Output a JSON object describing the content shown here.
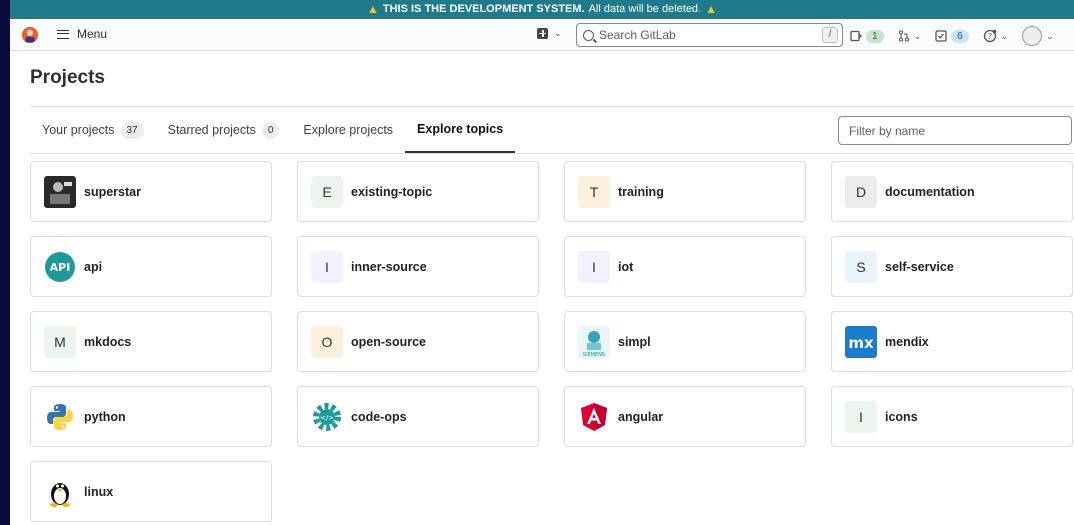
{
  "banner": {
    "strong": "THIS IS THE DEVELOPMENT SYSTEM.",
    "text": "All data will be deleted."
  },
  "header": {
    "menu_label": "Menu",
    "search_placeholder": "Search GitLab",
    "search_shortcut": "/",
    "issues_count": "1",
    "todos_count": "6"
  },
  "page": {
    "title": "Projects",
    "tabs": [
      {
        "label": "Your projects",
        "count": "37"
      },
      {
        "label": "Starred projects",
        "count": "0"
      },
      {
        "label": "Explore projects"
      },
      {
        "label": "Explore topics"
      }
    ],
    "filter_placeholder": "Filter by name"
  },
  "topics": [
    {
      "name": "superstar",
      "letter": "",
      "icon": "superstar-photo",
      "bg": "#333333"
    },
    {
      "name": "existing-topic",
      "letter": "E",
      "bg": "#ecf4ee"
    },
    {
      "name": "training",
      "letter": "T",
      "bg": "#fdf1dd"
    },
    {
      "name": "documentation",
      "letter": "D",
      "bg": "#ececef"
    },
    {
      "name": "api",
      "letter": "",
      "icon": "api-logo",
      "bg": "#1d9a9a"
    },
    {
      "name": "inner-source",
      "letter": "I",
      "bg": "#f4f0ff"
    },
    {
      "name": "iot",
      "letter": "I",
      "bg": "#f4f0ff"
    },
    {
      "name": "self-service",
      "letter": "S",
      "bg": "#e9f3fc"
    },
    {
      "name": "mkdocs",
      "letter": "M",
      "bg": "#ecf4ee"
    },
    {
      "name": "open-source",
      "letter": "O",
      "bg": "#fdf1dd"
    },
    {
      "name": "simpl",
      "letter": "",
      "icon": "siemens-simpl-logo",
      "bg": "#eaf6f8"
    },
    {
      "name": "mendix",
      "letter": "",
      "icon": "mendix-logo",
      "bg": "#1a7ccf"
    },
    {
      "name": "python",
      "letter": "",
      "icon": "python-logo",
      "bg": "#ffffff"
    },
    {
      "name": "code-ops",
      "letter": "",
      "icon": "code-ops-gear-logo",
      "bg": "#ffffff"
    },
    {
      "name": "angular",
      "letter": "",
      "icon": "angular-logo",
      "bg": "#ffffff"
    },
    {
      "name": "icons",
      "letter": "I",
      "bg": "#ecf4ee"
    },
    {
      "name": "linux",
      "letter": "",
      "icon": "linux-tux-logo",
      "bg": "#ffffff"
    }
  ]
}
